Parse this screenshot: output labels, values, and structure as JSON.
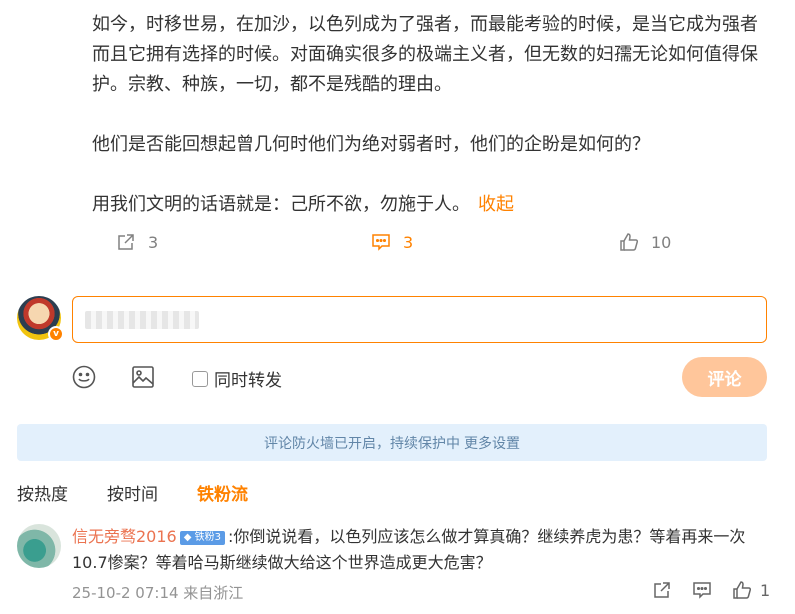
{
  "post": {
    "para1": "如今，时移世易，在加沙，以色列成为了强者，而最能考验的时候，是当它成为强者而且它拥有选择的时候。对面确实很多的极端主义者，但无数的妇孺无论如何值得保护。宗教、种族，一切，都不是残酷的理由。",
    "para2": "他们是否能回想起曾几何时他们为绝对弱者时，他们的企盼是如何的？",
    "para3": "用我们文明的话语就是：己所不欲，勿施于人。",
    "collapse_label": "收起"
  },
  "actions": {
    "share_count": "3",
    "comment_count": "3",
    "like_count": "10"
  },
  "composer": {
    "repost_label": "同时转发",
    "submit_label": "评论"
  },
  "firewall": {
    "text": "评论防火墙已开启，持续保护中",
    "more_label": "更多设置"
  },
  "sort_tabs": [
    {
      "label": "按热度"
    },
    {
      "label": "按时间"
    },
    {
      "label": "铁粉流"
    }
  ],
  "comment": {
    "user": "信无旁骛2016",
    "badge": "铁粉3",
    "text": ":你倒说说看，以色列应该怎么做才算真确？继续养虎为患？等着再来一次10.7惨案？等着哈马斯继续做大给这个世界造成更大危害？",
    "meta": "25-10-2 07:14 来自浙江",
    "like_count": "1"
  },
  "colors": {
    "accent": "#ff8200",
    "firewall_bg": "#e3f0fc",
    "username": "#eb7350"
  }
}
